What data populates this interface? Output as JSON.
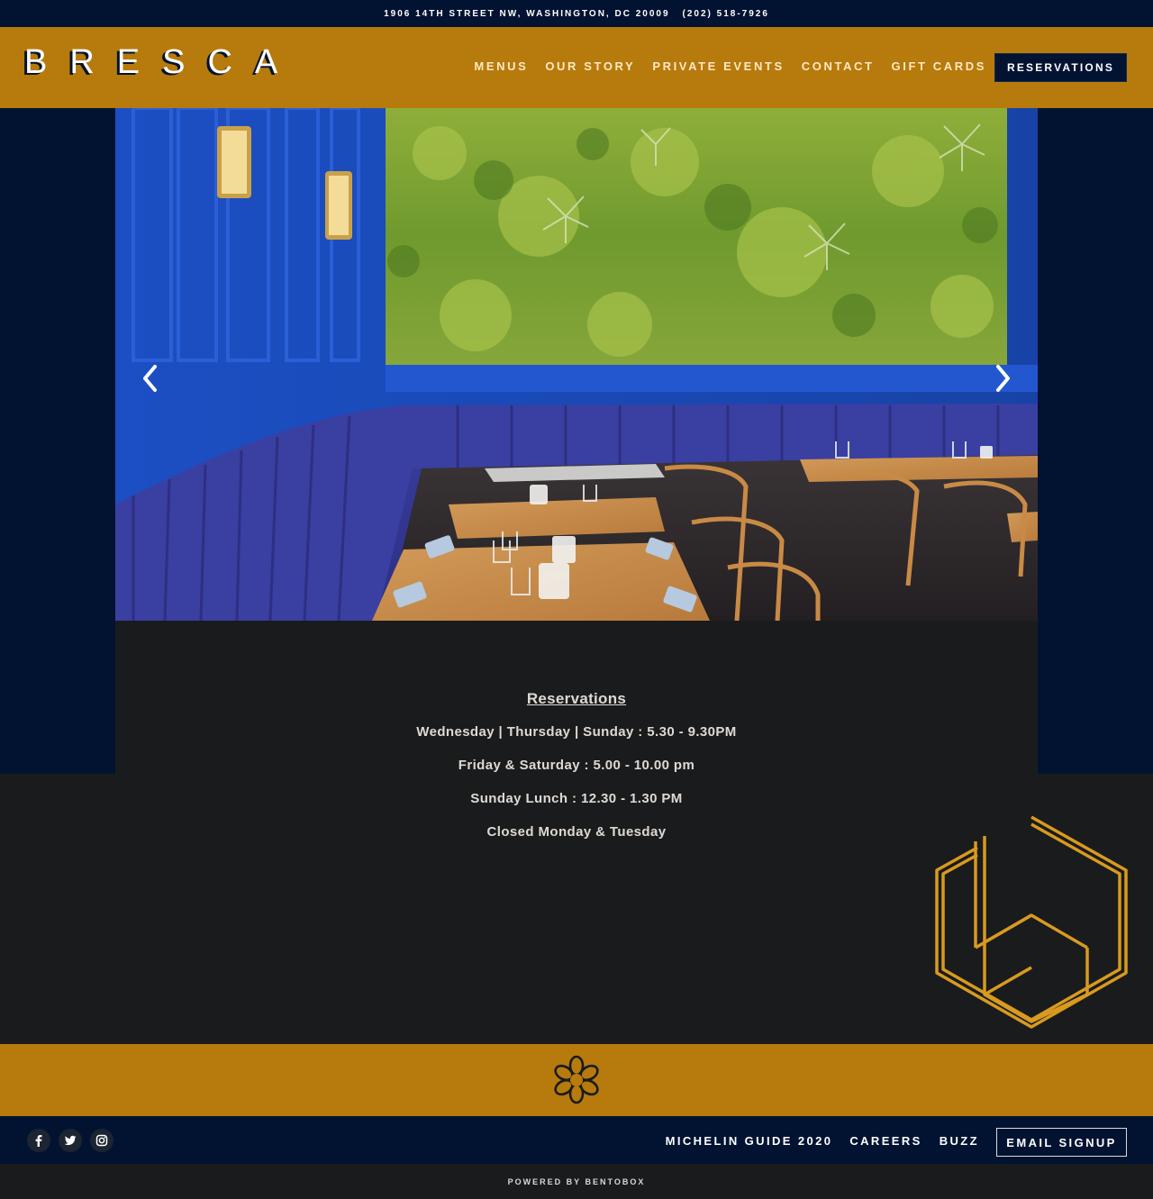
{
  "topbar": {
    "address": "1906 14TH STREET NW, WASHINGTON, DC 20009",
    "phone": "(202) 518-7926"
  },
  "header": {
    "logo": "BRESCA",
    "nav": [
      "MENUS",
      "OUR STORY",
      "PRIVATE EVENTS",
      "CONTACT",
      "GIFT CARDS"
    ],
    "reserve_label": "RESERVATIONS"
  },
  "hours": {
    "title": "Reservations",
    "lines": [
      "Wednesday | Thursday | Sunday : 5.30 - 9.30PM",
      "Friday & Saturday : 5.00 - 10.00 pm",
      "Sunday Lunch : 12.30 - 1.30 PM",
      "Closed Monday & Tuesday"
    ]
  },
  "footer": {
    "social": [
      "facebook-icon",
      "twitter-icon",
      "instagram-icon"
    ],
    "links": [
      "MICHELIN GUIDE 2020",
      "CAREERS",
      "BUZZ"
    ],
    "email_label": "EMAIL SIGNUP",
    "powered": "POWERED BY BENTOBOX"
  },
  "colors": {
    "navy": "#021332",
    "gold": "#b77a0d",
    "charcoal": "#1a1b1d"
  }
}
